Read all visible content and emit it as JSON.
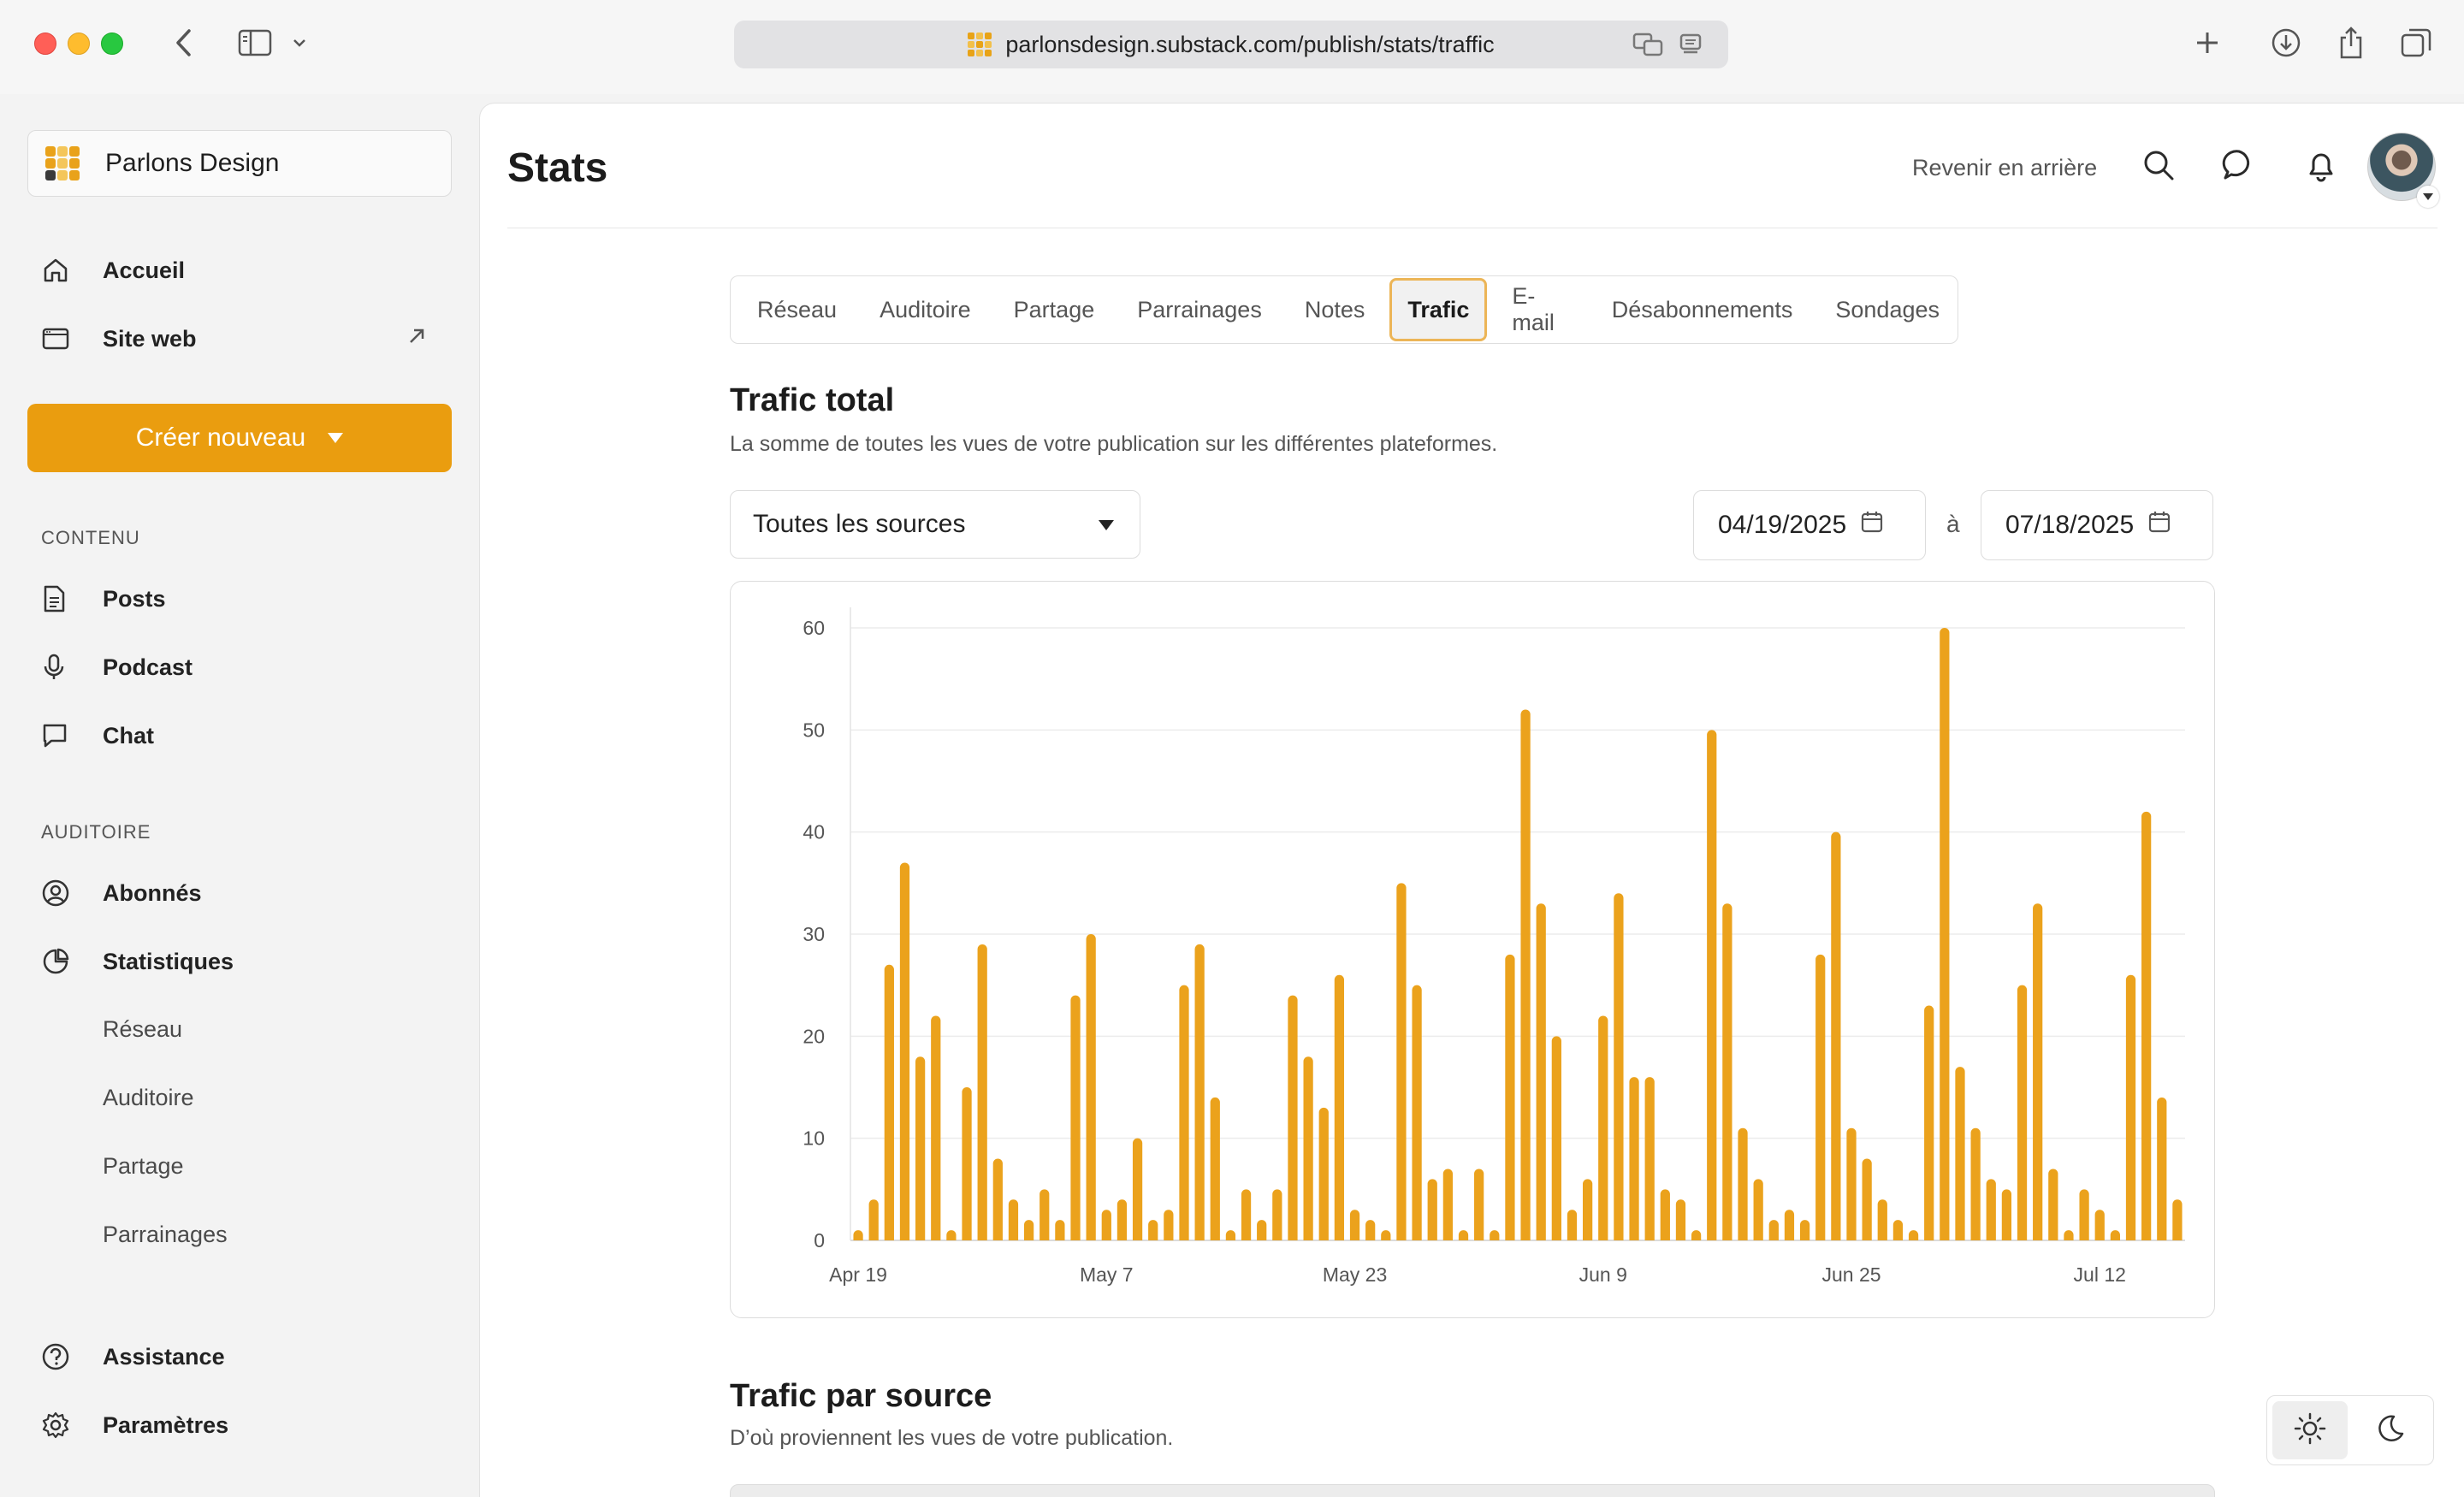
{
  "browser": {
    "url": "parlonsdesign.substack.com/publish/stats/traffic"
  },
  "sidebar": {
    "publication_name": "Parlons Design",
    "nav": [
      {
        "label": "Accueil",
        "icon": "home-icon"
      },
      {
        "label": "Site web",
        "icon": "browser-window-icon"
      }
    ],
    "create_label": "Créer nouveau",
    "section_content": "CONTENU",
    "content_items": [
      {
        "label": "Posts",
        "icon": "document-icon"
      },
      {
        "label": "Podcast",
        "icon": "microphone-icon"
      },
      {
        "label": "Chat",
        "icon": "chat-bubble-icon"
      }
    ],
    "section_audience": "AUDITOIRE",
    "audience_items": [
      {
        "label": "Abonnés",
        "icon": "user-circle-icon"
      },
      {
        "label": "Statistiques",
        "icon": "pie-chart-icon"
      }
    ],
    "stats_sub_items": [
      "Réseau",
      "Auditoire",
      "Partage",
      "Parrainages"
    ],
    "bottom_items": [
      {
        "label": "Assistance",
        "icon": "help-circle-icon"
      },
      {
        "label": "Paramètres",
        "icon": "gear-icon"
      }
    ]
  },
  "header": {
    "title": "Stats",
    "back_label": "Revenir en arrière"
  },
  "tabs": [
    {
      "label": "Réseau",
      "active": false
    },
    {
      "label": "Auditoire",
      "active": false
    },
    {
      "label": "Partage",
      "active": false
    },
    {
      "label": "Parrainages",
      "active": false
    },
    {
      "label": "Notes",
      "active": false
    },
    {
      "label": "Trafic",
      "active": true
    },
    {
      "label": "E-mail",
      "active": false
    },
    {
      "label": "Désabonnements",
      "active": false
    },
    {
      "label": "Sondages",
      "active": false
    }
  ],
  "total": {
    "title": "Trafic total",
    "subtitle": "La somme de toutes les vues de votre publication sur les différentes plateformes.",
    "source_select": "Toutes les sources",
    "date_from": "04/19/2025",
    "date_sep": "à",
    "date_to": "07/18/2025"
  },
  "by_source": {
    "title": "Trafic par source",
    "subtitle": "D’où proviennent les vues de votre publication."
  },
  "colors": {
    "accent": "#ea9d0f",
    "bar": "#eba21c"
  },
  "chart_data": {
    "type": "bar",
    "title": "",
    "xlabel": "",
    "ylabel": "",
    "ylim": [
      0,
      60
    ],
    "yticks": [
      0,
      10,
      20,
      30,
      40,
      50,
      60
    ],
    "xtick_labels": [
      {
        "label": "Apr 19",
        "index": 0
      },
      {
        "label": "May 7",
        "index": 16
      },
      {
        "label": "May 23",
        "index": 32
      },
      {
        "label": "Jun 9",
        "index": 48
      },
      {
        "label": "Jun 25",
        "index": 64
      },
      {
        "label": "Jul 12",
        "index": 80
      }
    ],
    "grid": true,
    "values": [
      1,
      4,
      27,
      37,
      18,
      22,
      1,
      15,
      29,
      8,
      4,
      2,
      5,
      2,
      24,
      30,
      3,
      4,
      10,
      2,
      3,
      25,
      29,
      14,
      1,
      5,
      2,
      5,
      24,
      18,
      13,
      26,
      3,
      2,
      1,
      35,
      25,
      6,
      7,
      1,
      7,
      1,
      28,
      52,
      33,
      20,
      3,
      6,
      22,
      34,
      16,
      16,
      5,
      4,
      1,
      50,
      33,
      11,
      6,
      2,
      3,
      2,
      28,
      40,
      11,
      8,
      4,
      2,
      1,
      23,
      60,
      17,
      11,
      6,
      5,
      25,
      33,
      7,
      1,
      5,
      3,
      1,
      26,
      42,
      14,
      4
    ]
  }
}
